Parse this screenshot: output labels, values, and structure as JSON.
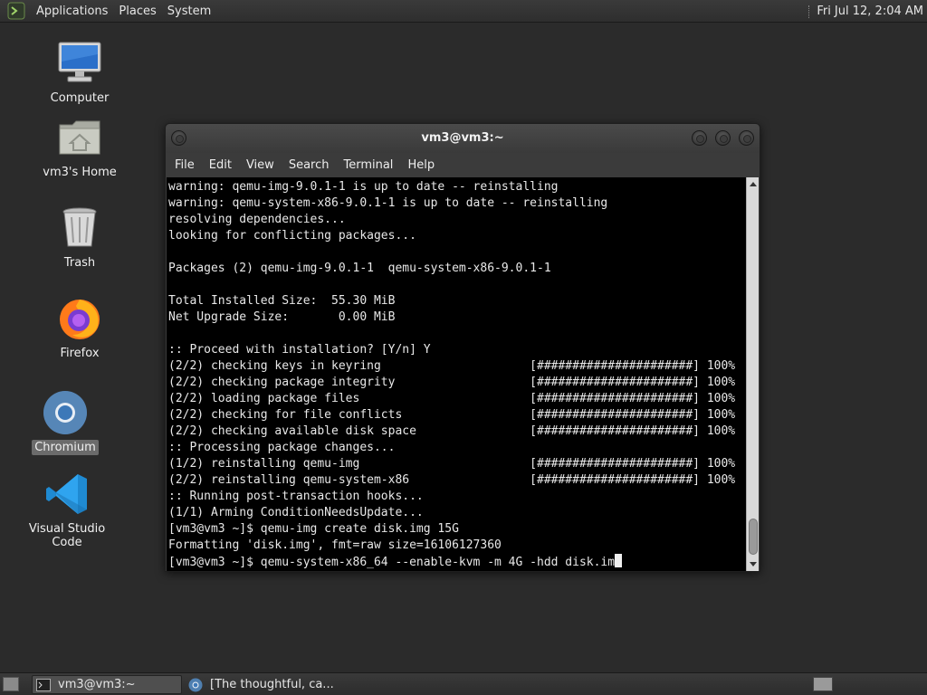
{
  "top_panel": {
    "menus": [
      "Applications",
      "Places",
      "System"
    ],
    "clock": "Fri Jul 12, 2:04 AM"
  },
  "desktop_icons": [
    {
      "label": "Computer",
      "icon": "computer-icon"
    },
    {
      "label": "vm3's Home",
      "icon": "home-folder-icon"
    },
    {
      "label": "Trash",
      "icon": "trash-icon"
    },
    {
      "label": "Firefox",
      "icon": "firefox-icon"
    },
    {
      "label": "Chromium",
      "icon": "chromium-icon",
      "selected": true
    },
    {
      "label": "Visual Studio Code",
      "icon": "vscode-icon"
    }
  ],
  "terminal_window": {
    "title": "vm3@vm3:~",
    "menus": [
      "File",
      "Edit",
      "View",
      "Search",
      "Terminal",
      "Help"
    ],
    "lines": [
      "warning: qemu-img-9.0.1-1 is up to date -- reinstalling",
      "warning: qemu-system-x86-9.0.1-1 is up to date -- reinstalling",
      "resolving dependencies...",
      "looking for conflicting packages...",
      "",
      "Packages (2) qemu-img-9.0.1-1  qemu-system-x86-9.0.1-1",
      "",
      "Total Installed Size:  55.30 MiB",
      "Net Upgrade Size:       0.00 MiB",
      "",
      ":: Proceed with installation? [Y/n] Y",
      "(2/2) checking keys in keyring                     [######################] 100%",
      "(2/2) checking package integrity                   [######################] 100%",
      "(2/2) loading package files                        [######################] 100%",
      "(2/2) checking for file conflicts                  [######################] 100%",
      "(2/2) checking available disk space                [######################] 100%",
      ":: Processing package changes...",
      "(1/2) reinstalling qemu-img                        [######################] 100%",
      "(2/2) reinstalling qemu-system-x86                 [######################] 100%",
      ":: Running post-transaction hooks...",
      "(1/1) Arming ConditionNeedsUpdate...",
      "[vm3@vm3 ~]$ qemu-img create disk.img 15G",
      "Formatting 'disk.img', fmt=raw size=16106127360"
    ],
    "prompt_line": "[vm3@vm3 ~]$ qemu-system-x86_64 --enable-kvm -m 4G -hdd disk.im"
  },
  "taskbar": {
    "tasks": [
      {
        "label": "vm3@vm3:~",
        "icon": "terminal-icon",
        "active": true
      },
      {
        "label": "[The thoughtful, ca...",
        "icon": "chromium-icon",
        "active": false
      }
    ]
  },
  "colors": {
    "desktop_bg": "#2b2b2b",
    "terminal_bg": "#000000",
    "terminal_fg": "#e8e8e8"
  }
}
